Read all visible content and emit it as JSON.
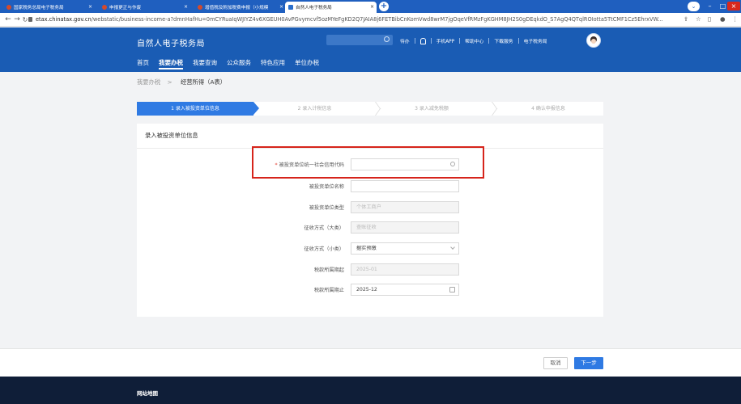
{
  "browser": {
    "tabs": [
      {
        "title": "国家税务总局电子税务局",
        "active": false
      },
      {
        "title": "申报更正与作废",
        "active": false
      },
      {
        "title": "增值税及附加税费申报（小规模",
        "active": false
      },
      {
        "title": "自然人电子税务局",
        "active": true
      }
    ],
    "url_host": "etax.chinatax.gov.cn",
    "url_path": "/webstatic/business-income-a?dmnHafHu=0mCYRuaIqWJIYZ4v6XGEUH0AvPGvymcvf5ozMYeFgKD2Q7JAIA8j6FETBibCnKomVwd8wrM7jgOqeVfRMzFgKGHM8JH2S0gDEqkdO_S7AgQ4QTqlROIotta5TtCMF1Cz5EhrxVW...",
    "window_controls": [
      "chevron-down-icon",
      "minimize-icon",
      "maximize-icon",
      "close-icon"
    ]
  },
  "header": {
    "site_title": "自然人电子税务局",
    "search_placeholder": "",
    "links": [
      "待办",
      "手机APP",
      "帮助中心",
      "下载服务",
      "电子税务局"
    ],
    "nav": [
      {
        "label": "首页",
        "active": false
      },
      {
        "label": "我要办税",
        "active": true
      },
      {
        "label": "我要查询",
        "active": false
      },
      {
        "label": "公众服务",
        "active": false
      },
      {
        "label": "特色应用",
        "active": false
      },
      {
        "label": "单位办税",
        "active": false
      }
    ]
  },
  "breadcrumb": {
    "parent": "我要办税",
    "separator": ">",
    "current": "经营所得（A表）"
  },
  "steps": [
    {
      "label": "1  录入被投资单位信息",
      "active": true
    },
    {
      "label": "2  录入计税信息",
      "active": false
    },
    {
      "label": "3  录入减免税额",
      "active": false
    },
    {
      "label": "4  确认申报信息",
      "active": false
    }
  ],
  "form": {
    "section_title": "录入被投资单位信息",
    "fields": [
      {
        "label": "被投资单位统一社会信用代码",
        "required": true,
        "value": "",
        "state": "search"
      },
      {
        "label": "被投资单位名称",
        "required": false,
        "value": "",
        "state": "text"
      },
      {
        "label": "被投资单位类型",
        "required": false,
        "value": "个体工商户",
        "state": "disabled"
      },
      {
        "label": "征收方式（大类）",
        "required": false,
        "value": "查账征收",
        "state": "disabled"
      },
      {
        "label": "征收方式（小类）",
        "required": false,
        "value": "据实预缴",
        "state": "select"
      },
      {
        "label": "税款所属期起",
        "required": false,
        "value": "2025-01",
        "state": "disabled"
      },
      {
        "label": "税款所属期止",
        "required": false,
        "value": "2025-12",
        "state": "date"
      }
    ]
  },
  "actions": {
    "cancel": "取消",
    "next": "下一步"
  },
  "footer": {
    "link": "网站地图"
  },
  "colors": {
    "brand_blue": "#1a5cb4",
    "accent_blue": "#2f7ae3",
    "highlight_red": "#d6241b",
    "footer_bg": "#0f1e38"
  }
}
